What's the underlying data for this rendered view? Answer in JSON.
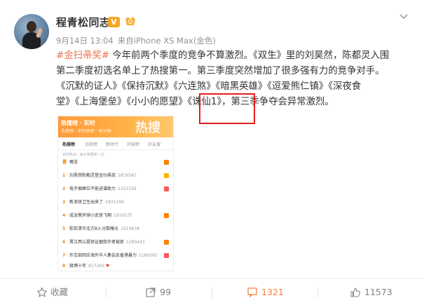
{
  "post": {
    "user_name": "程青松同志",
    "verified_badge": "V",
    "meta": {
      "date": "9月14日 13:04",
      "source_prefix": "来自",
      "device": "iPhone XS Max(金色)"
    },
    "text": {
      "hashtag": "#金扫帚奖#",
      "line1_rest": " 今年前两个季度的竞争不算激烈。《双生》里的刘昊然，陈都灵入围",
      "line2": "第二季度初选名单上了热搜第一。第三季度突然增加了很多强有力的竞争对手。",
      "line3": "《沉默的证人》《保持沉默》《六连煞》《暗黑英雄》《逗爱熊仁镇》《深夜食",
      "line4": "堂》《上海堡垒》《小小的愿望》《诛仙1》，第三季争夺会异常激烈。"
    },
    "image": {
      "banner_small": "热搜榜 · 实时",
      "banner_big": "热搜",
      "banner_sub": "热搜榜 · 实时更新 · 每分钟",
      "tabs": [
        "热搜榜",
        "话题榜",
        "新时代",
        "同城榜",
        "好友搜"
      ],
      "sub_note": "实时热点，每分钟更新一次",
      "rows": [
        {
          "rank": "置",
          "title": "概览",
          "hot": ""
        },
        {
          "rank": "1",
          "title": "刘昊然陈都灵登金扫帚奖",
          "hot": "2876587"
        },
        {
          "rank": "2",
          "title": "电子烟摊位不能进课致力",
          "hot": "2322159"
        },
        {
          "rank": "3",
          "title": "新浪体卫生出来了",
          "hot": "1931306"
        },
        {
          "rank": "4",
          "title": "成龙携伴骑小武侠飞翔",
          "hot": "1910575"
        },
        {
          "rank": "5",
          "title": "陈若清华北方B入分数曝光",
          "hot": "1610878"
        },
        {
          "rank": "6",
          "title": "晋江西认提供证据我作者被抓",
          "hot": "1285443"
        },
        {
          "rank": "7",
          "title": "外交部回应海外华人集会反香港暴力",
          "hot": "1180365"
        },
        {
          "rank": "8",
          "title": "微博十年",
          "hot": "817260"
        }
      ]
    },
    "actions": {
      "favorite_label": "收藏",
      "repost_count": "99",
      "comment_count": "1321",
      "like_count": "11573"
    }
  },
  "colors": {
    "hashtag": "#eb7350",
    "highlight_box": "#e31e1e",
    "like_accent": "#fa7d3c",
    "verified": "#f5a623",
    "banner": "#ffa53c"
  }
}
